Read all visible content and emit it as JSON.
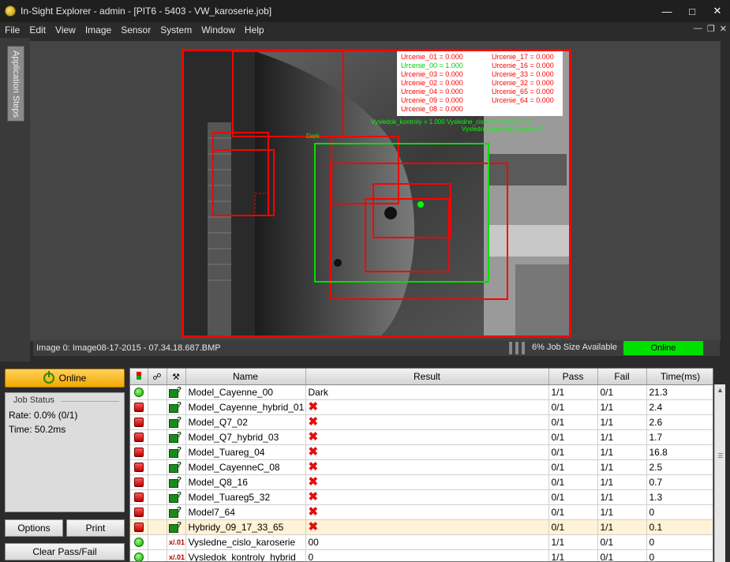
{
  "window": {
    "title": "In-Sight Explorer - admin - [PIT6 - 5403 - VW_karoserie.job]",
    "controls": [
      "minimize-icon",
      "maximize-icon",
      "close-icon"
    ]
  },
  "menu": [
    "File",
    "Edit",
    "View",
    "Image",
    "Sensor",
    "System",
    "Window",
    "Help"
  ],
  "sidebar": {
    "tab_label": "Application Steps"
  },
  "image_overlay": {
    "left_col": [
      {
        "text": "Urcenie_01 = 0.000",
        "color": "#ff0000"
      },
      {
        "text": "Urcenie_00 = 1.000",
        "color": "#00ff00"
      },
      {
        "text": "Urcenie_03 = 0.000",
        "color": "#ff0000"
      },
      {
        "text": "Urcenie_02 = 0.000",
        "color": "#ff0000"
      },
      {
        "text": "Urcenie_04 = 0.000",
        "color": "#ff0000"
      },
      {
        "text": "Urcenie_09 = 0.000",
        "color": "#ff0000"
      },
      {
        "text": "Urcenie_08 = 0.000",
        "color": "#ff0000"
      }
    ],
    "right_col": [
      {
        "text": "Urcenie_17 = 0.000",
        "color": "#ff0000"
      },
      {
        "text": "Urcenie_16 = 0.000",
        "color": "#ff0000"
      },
      {
        "text": "Urcenie_33 = 0.000",
        "color": "#ff0000"
      },
      {
        "text": "Urcenie_32 = 0.000",
        "color": "#ff0000"
      },
      {
        "text": "Urcenie_65 = 0.000",
        "color": "#ff0000"
      },
      {
        "text": "Urcenie_64 = 0.000",
        "color": "#ff0000"
      }
    ],
    "line1": "Vysledok_kontroly = 1.000  Vysledne_cislo_karoserie = 00",
    "line2": "Vysledok_kontroly_hybrid = 0",
    "dark_label": "Dark"
  },
  "image_status": {
    "filename": "Image 0: Image08-17-2015 - 07.34.18.687.BMP",
    "job_size": "6% Job Size Available",
    "online": "Online"
  },
  "controls_panel": {
    "online_button": "Online",
    "job_status_title": "Job Status",
    "rate": "Rate: 0.0% (0/1)",
    "time": "Time: 50.2ms",
    "options_button": "Options",
    "print_button": "Print",
    "clear_button": "Clear Pass/Fail"
  },
  "results_table": {
    "columns": [
      "",
      "",
      "",
      "Name",
      "Result",
      "Pass",
      "Fail",
      "Time(ms)"
    ],
    "rows": [
      {
        "status": "green",
        "icon": "tool",
        "name": "Model_Cayenne_00",
        "result": "Dark",
        "result_x": false,
        "pass": "1/1",
        "fail": "0/1",
        "time": "21.3"
      },
      {
        "status": "red",
        "icon": "tool",
        "name": "Model_Cayenne_hybrid_01",
        "result": "",
        "result_x": true,
        "pass": "0/1",
        "fail": "1/1",
        "time": "2.4"
      },
      {
        "status": "red",
        "icon": "tool",
        "name": "Model_Q7_02",
        "result": "",
        "result_x": true,
        "pass": "0/1",
        "fail": "1/1",
        "time": "2.6"
      },
      {
        "status": "red",
        "icon": "tool",
        "name": "Model_Q7_hybrid_03",
        "result": "",
        "result_x": true,
        "pass": "0/1",
        "fail": "1/1",
        "time": "1.7"
      },
      {
        "status": "red",
        "icon": "tool",
        "name": "Model_Tuareg_04",
        "result": "",
        "result_x": true,
        "pass": "0/1",
        "fail": "1/1",
        "time": "16.8"
      },
      {
        "status": "red",
        "icon": "tool",
        "name": "Model_CayenneC_08",
        "result": "",
        "result_x": true,
        "pass": "0/1",
        "fail": "1/1",
        "time": "2.5"
      },
      {
        "status": "red",
        "icon": "tool",
        "name": "Model_Q8_16",
        "result": "",
        "result_x": true,
        "pass": "0/1",
        "fail": "1/1",
        "time": "0.7"
      },
      {
        "status": "red",
        "icon": "tool",
        "name": "Model_Tuareg5_32",
        "result": "",
        "result_x": true,
        "pass": "0/1",
        "fail": "1/1",
        "time": "1.3"
      },
      {
        "status": "red",
        "icon": "tool",
        "name": "Model7_64",
        "result": "",
        "result_x": true,
        "pass": "0/1",
        "fail": "1/1",
        "time": "0"
      },
      {
        "status": "red",
        "icon": "tool",
        "name": "Hybridy_09_17_33_65",
        "result": "",
        "result_x": true,
        "pass": "0/1",
        "fail": "1/1",
        "time": "0.1",
        "selected": true
      },
      {
        "status": "green",
        "icon": "fx",
        "name": "Vysledne_cislo_karoserie",
        "result": "00",
        "result_x": false,
        "pass": "1/1",
        "fail": "0/1",
        "time": "0"
      },
      {
        "status": "green",
        "icon": "fx",
        "name": "Vysledok_kontroly_hybrid",
        "result": "0",
        "result_x": false,
        "pass": "1/1",
        "fail": "0/1",
        "time": "0"
      }
    ]
  }
}
